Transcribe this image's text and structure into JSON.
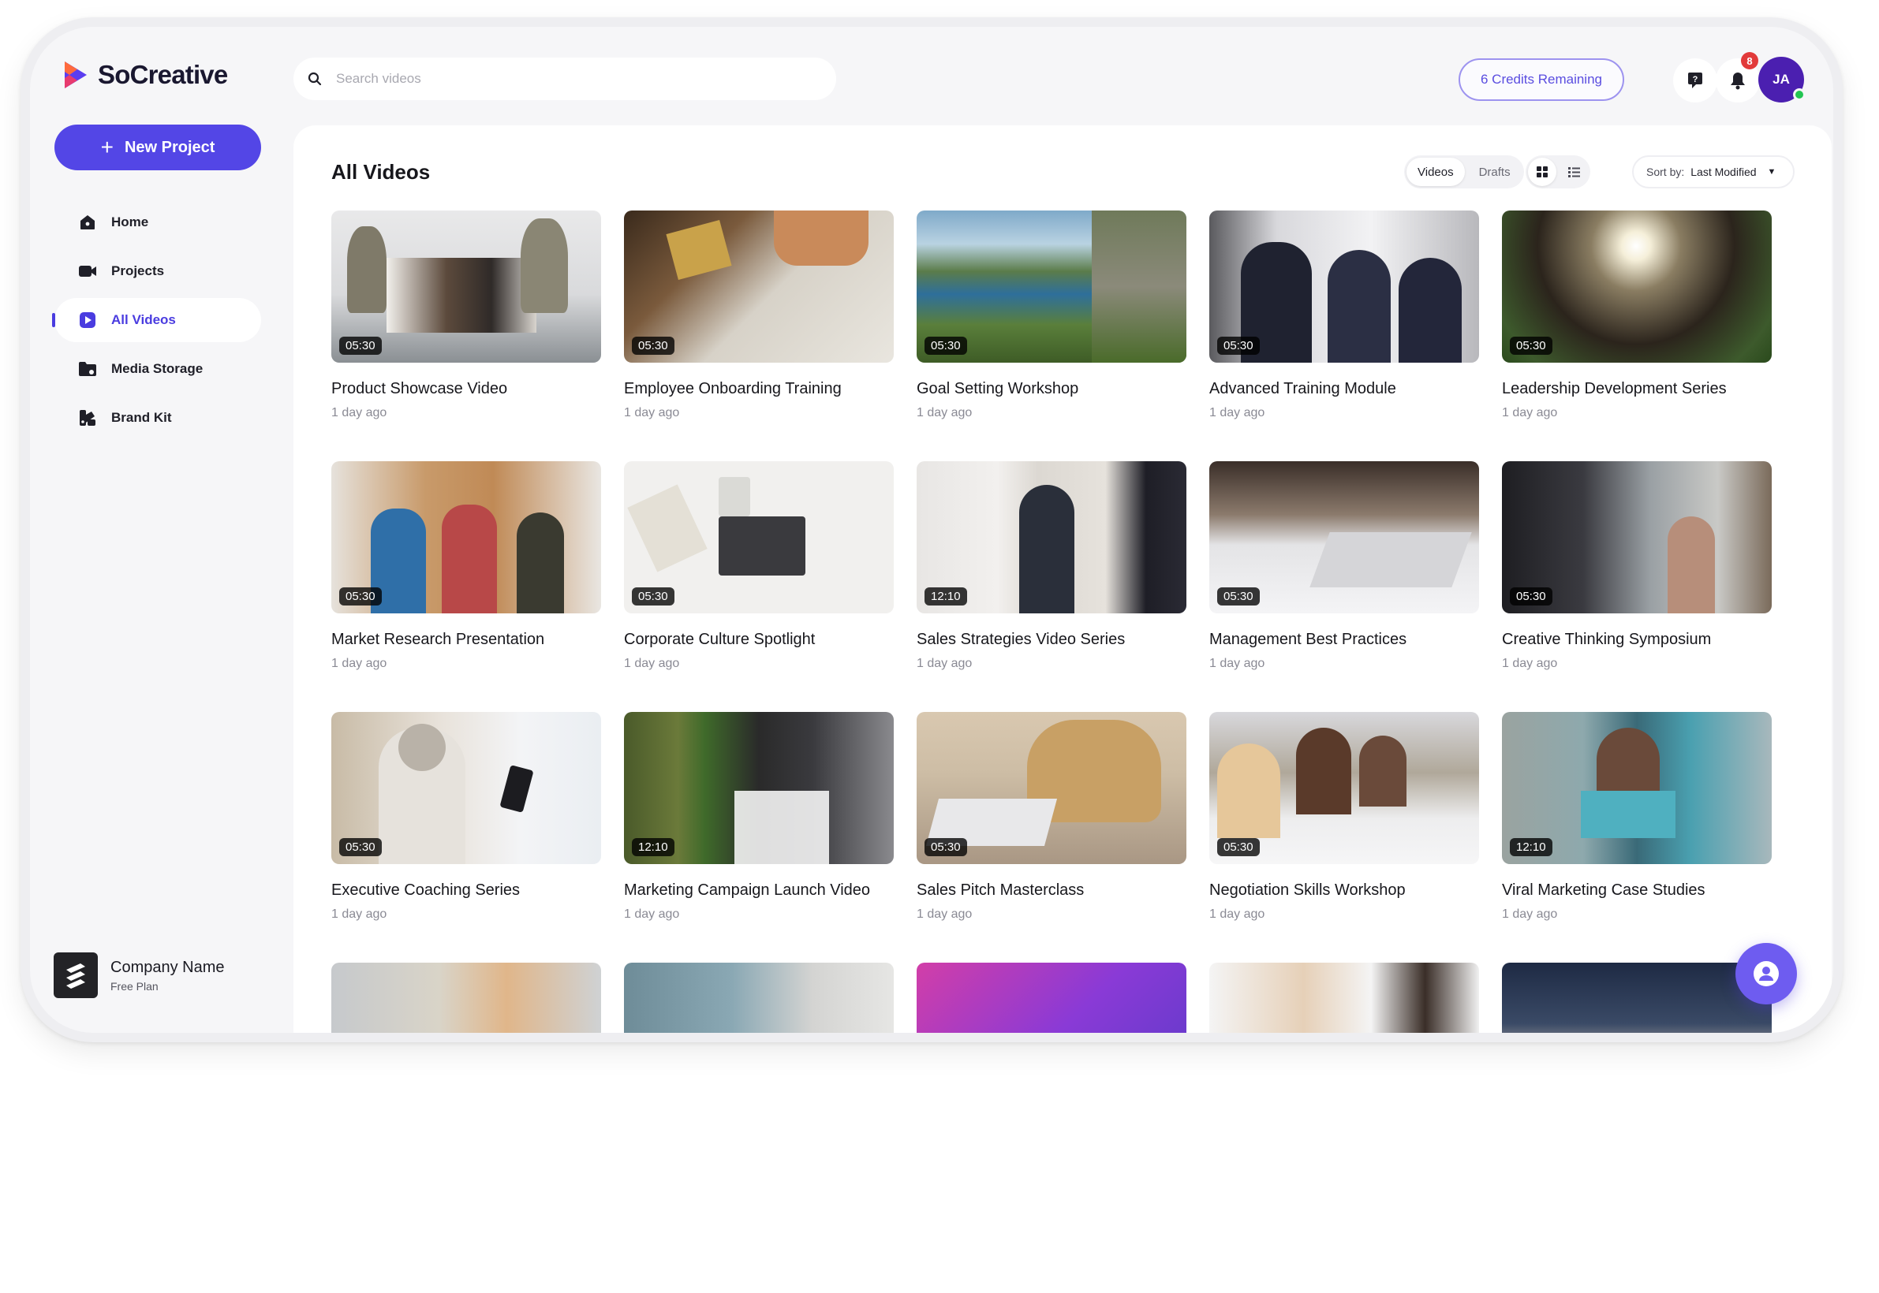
{
  "app": {
    "name": "SoCreative"
  },
  "sidebar": {
    "new_project_label": "New Project",
    "items": [
      {
        "label": "Home",
        "icon": "home-icon"
      },
      {
        "label": "Projects",
        "icon": "video-camera-icon"
      },
      {
        "label": "All Videos",
        "icon": "play-icon",
        "active": true
      },
      {
        "label": "Media Storage",
        "icon": "folder-icon"
      },
      {
        "label": "Brand Kit",
        "icon": "brand-kit-icon"
      }
    ],
    "company": {
      "name": "Company Name",
      "plan": "Free Plan"
    }
  },
  "topbar": {
    "search_placeholder": "Search videos",
    "credits_label": "6 Credits Remaining",
    "notification_count": "8",
    "avatar_initials": "JA"
  },
  "main": {
    "title": "All Videos",
    "tabs": [
      {
        "label": "Videos",
        "active": true
      },
      {
        "label": "Drafts",
        "active": false
      }
    ],
    "view_mode": "grid",
    "sort": {
      "label": "Sort by:",
      "value": "Last Modified"
    }
  },
  "videos": [
    {
      "title": "Product Showcase Video",
      "time": "1 day ago",
      "duration": "05:30"
    },
    {
      "title": "Employee Onboarding Training",
      "time": "1 day ago",
      "duration": "05:30"
    },
    {
      "title": "Goal Setting Workshop",
      "time": "1 day ago",
      "duration": "05:30"
    },
    {
      "title": "Advanced Training Module",
      "time": "1 day ago",
      "duration": "05:30"
    },
    {
      "title": "Leadership Development Series",
      "time": "1 day ago",
      "duration": "05:30"
    },
    {
      "title": "Market Research Presentation",
      "time": "1 day ago",
      "duration": "05:30"
    },
    {
      "title": "Corporate Culture Spotlight",
      "time": "1 day ago",
      "duration": "05:30"
    },
    {
      "title": "Sales Strategies Video Series",
      "time": "1 day ago",
      "duration": "12:10"
    },
    {
      "title": "Management Best Practices",
      "time": "1 day ago",
      "duration": "05:30"
    },
    {
      "title": "Creative Thinking Symposium",
      "time": "1 day ago",
      "duration": "05:30"
    },
    {
      "title": "Executive Coaching Series",
      "time": "1 day ago",
      "duration": "05:30"
    },
    {
      "title": "Marketing Campaign Launch Video",
      "time": "1 day ago",
      "duration": "12:10"
    },
    {
      "title": "Sales Pitch Masterclass",
      "time": "1 day ago",
      "duration": "05:30"
    },
    {
      "title": "Negotiation Skills Workshop",
      "time": "1 day ago",
      "duration": "05:30"
    },
    {
      "title": "Viral Marketing Case Studies",
      "time": "1 day ago",
      "duration": "12:10"
    }
  ],
  "colors": {
    "accent": "#5346e6",
    "badge": "#e23a3a",
    "avatar": "#4b1fb0",
    "online": "#23c552"
  }
}
